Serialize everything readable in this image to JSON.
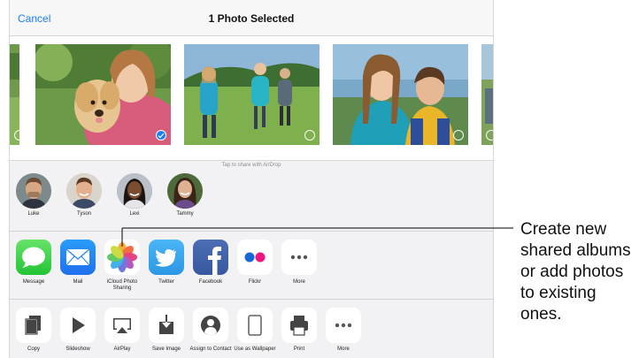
{
  "nav": {
    "cancel_label": "Cancel",
    "title": "1 Photo Selected"
  },
  "photos": [
    {
      "subject": "girl with puppy",
      "selected": true
    },
    {
      "subject": "kids walking in meadow",
      "selected": false
    },
    {
      "subject": "girl and boy smiling",
      "selected": false
    }
  ],
  "airdrop": {
    "hint": "Tap to share with AirDrop",
    "people": [
      {
        "name": "Luke"
      },
      {
        "name": "Tyson"
      },
      {
        "name": "Lexi"
      },
      {
        "name": "Tammy"
      }
    ]
  },
  "share_apps": [
    {
      "label": "Message",
      "icon": "message-icon"
    },
    {
      "label": "Mail",
      "icon": "mail-icon"
    },
    {
      "label": "iCloud Photo Sharing",
      "icon": "photos-icon"
    },
    {
      "label": "Twitter",
      "icon": "twitter-icon"
    },
    {
      "label": "Facebook",
      "icon": "facebook-icon"
    },
    {
      "label": "Flickr",
      "icon": "flickr-icon"
    },
    {
      "label": "More",
      "icon": "more-icon"
    }
  ],
  "actions": [
    {
      "label": "Copy",
      "icon": "copy-icon"
    },
    {
      "label": "Slideshow",
      "icon": "play-icon"
    },
    {
      "label": "AirPlay",
      "icon": "airplay-icon"
    },
    {
      "label": "Save Image",
      "icon": "save-icon"
    },
    {
      "label": "Assign to Contact",
      "icon": "contact-icon"
    },
    {
      "label": "Use as Wallpaper",
      "icon": "device-icon"
    },
    {
      "label": "Print",
      "icon": "print-icon"
    },
    {
      "label": "More",
      "icon": "more-icon"
    }
  ],
  "callout": {
    "text": "Create new shared albums or add photos to existing ones."
  },
  "colors": {
    "accent": "#1a7df6",
    "sheet_bg": "#f2f2f4"
  }
}
